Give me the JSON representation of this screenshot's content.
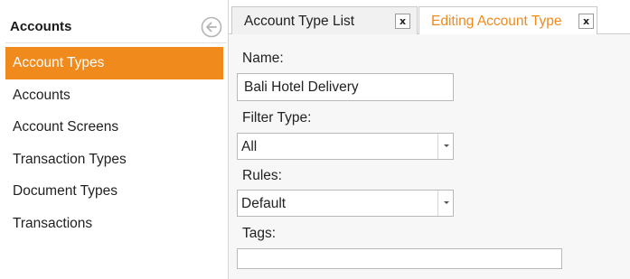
{
  "sidebar": {
    "title": "Accounts",
    "items": [
      {
        "label": "Account Types",
        "active": true
      },
      {
        "label": "Accounts"
      },
      {
        "label": "Account Screens"
      },
      {
        "label": "Transaction Types"
      },
      {
        "label": "Document Types"
      },
      {
        "label": "Transactions"
      }
    ]
  },
  "tabs": [
    {
      "label": "Account Type List",
      "close": "x"
    },
    {
      "label": "Editing Account Type",
      "close": "x",
      "active": true
    }
  ],
  "form": {
    "name_label": "Name:",
    "name_value": "Bali Hotel Delivery",
    "filter_type_label": "Filter Type:",
    "filter_type_value": "All",
    "rules_label": "Rules:",
    "rules_value": "Default",
    "tags_label": "Tags:",
    "tags_value": ""
  },
  "colors": {
    "accent": "#f08a1c",
    "panel_background": "#f7f7f7"
  },
  "icons": {
    "collapse": "arrow-left-circle-icon",
    "dropdown": "chevron-down-icon"
  }
}
